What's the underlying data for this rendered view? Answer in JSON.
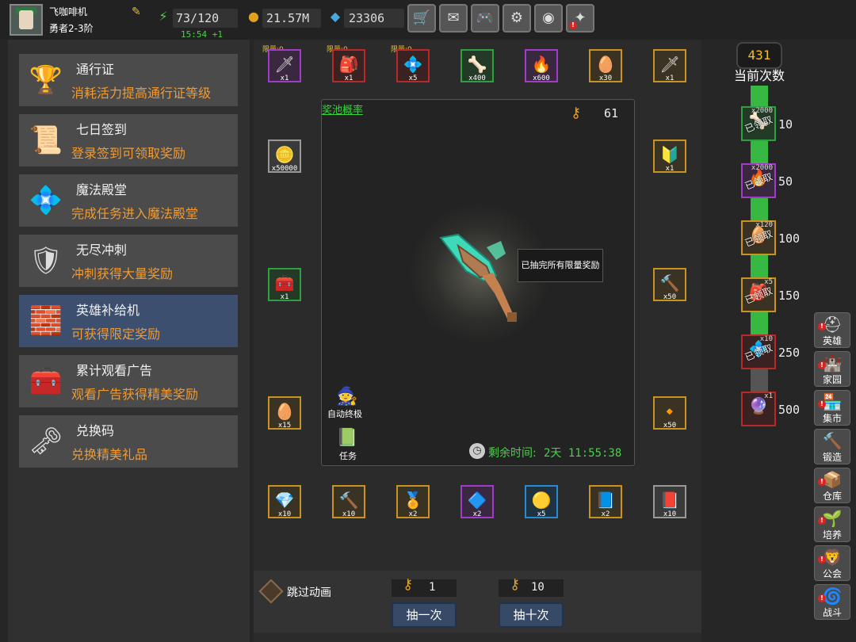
{
  "player": {
    "name": "飞咖啡机",
    "rank": "勇者2-3阶"
  },
  "resources": {
    "energy": "73/120",
    "energy_regen": "15:54 +1",
    "gold": "21.57M",
    "gems": "23306"
  },
  "top_buttons": [
    "shop-cart-icon",
    "mail-icon",
    "gamepad-icon",
    "settings-gear-icon",
    "colorwheel-icon",
    "sparkle-icon"
  ],
  "menu": [
    {
      "title": "通行证",
      "desc": "消耗活力提高通行证等级",
      "icon": "🏆"
    },
    {
      "title": "七日签到",
      "desc": "登录签到可领取奖励",
      "icon": "📜"
    },
    {
      "title": "魔法殿堂",
      "desc": "完成任务进入魔法殿堂",
      "icon": "💠"
    },
    {
      "title": "无尽冲刺",
      "desc": "冲刺获得大量奖励",
      "icon": "🛡"
    },
    {
      "title": "英雄补给机",
      "desc": "可获得限定奖励",
      "icon": "🧱",
      "active": true
    },
    {
      "title": "累计观看广告",
      "desc": "观看广告获得精美奖励",
      "icon": "🧰"
    },
    {
      "title": "兑换码",
      "desc": "兑换精美礼品",
      "icon": "🗝"
    }
  ],
  "pool": {
    "title": "奖池概率",
    "key_count": "61",
    "tooltip": "已抽完所有限量奖励",
    "auto_label": "自动终极",
    "task_label": "任务",
    "timer_label": "剩余时间:",
    "timer_value": "2天 11:55:38"
  },
  "limit_tag": "限量:0",
  "rewards_top": [
    {
      "count": "x1",
      "color": "purple",
      "icon": "🗡",
      "limited": true
    },
    {
      "count": "x1",
      "color": "red",
      "icon": "🎒",
      "limited": true
    },
    {
      "count": "x5",
      "color": "red",
      "icon": "💠",
      "limited": true
    },
    {
      "count": "x400",
      "color": "green",
      "icon": "🦴"
    },
    {
      "count": "x600",
      "color": "purple",
      "icon": "🔥"
    },
    {
      "count": "x30",
      "color": "gold",
      "icon": "🥚"
    },
    {
      "count": "x1",
      "color": "gold",
      "icon": "🗡"
    }
  ],
  "rewards_left": [
    {
      "count": "x50000",
      "color": "grey",
      "icon": "🪙"
    },
    {
      "count": "x1",
      "color": "green",
      "icon": "🧰"
    },
    {
      "count": "x15",
      "color": "gold",
      "icon": "🥚"
    }
  ],
  "rewards_right": [
    {
      "count": "x1",
      "color": "gold",
      "icon": "🔰"
    },
    {
      "count": "x50",
      "color": "gold",
      "icon": "🔨"
    },
    {
      "count": "x50",
      "color": "gold",
      "icon": "🔸"
    }
  ],
  "rewards_bottom": [
    {
      "count": "x10",
      "color": "gold",
      "icon": "💎"
    },
    {
      "count": "x10",
      "color": "gold",
      "icon": "🔨"
    },
    {
      "count": "x2",
      "color": "gold",
      "icon": "🏅"
    },
    {
      "count": "x2",
      "color": "purple",
      "icon": "🔷"
    },
    {
      "count": "x5",
      "color": "blue",
      "icon": "🟡"
    },
    {
      "count": "x2",
      "color": "gold",
      "icon": "📘"
    },
    {
      "count": "x10",
      "color": "grey",
      "icon": "📕"
    }
  ],
  "bottom": {
    "skip_label": "跳过动画",
    "single_cost": "1",
    "ten_cost": "10",
    "single_btn": "抽一次",
    "ten_btn": "抽十次"
  },
  "progress": {
    "draws": "431",
    "draws_label": "当前次数",
    "claimed_stamp": "已领取",
    "milestones": [
      {
        "value": "10",
        "count": "x2000",
        "color": "green",
        "icon": "🦴",
        "claimed": true
      },
      {
        "value": "50",
        "count": "x2000",
        "color": "purple",
        "icon": "🔥",
        "claimed": true
      },
      {
        "value": "100",
        "count": "x120",
        "color": "gold",
        "icon": "🥚",
        "claimed": true
      },
      {
        "value": "150",
        "count": "x5",
        "color": "gold",
        "icon": "🎒",
        "claimed": true
      },
      {
        "value": "250",
        "count": "x10",
        "color": "red",
        "icon": "💠",
        "claimed": true
      },
      {
        "value": "500",
        "count": "x1",
        "color": "red",
        "icon": "🔮",
        "claimed": false
      }
    ]
  },
  "nav": [
    {
      "label": "英雄",
      "icon": "⛑",
      "alert": true
    },
    {
      "label": "家园",
      "icon": "🏰",
      "alert": true
    },
    {
      "label": "集市",
      "icon": "🏪",
      "alert": true
    },
    {
      "label": "锻造",
      "icon": "🔨",
      "alert": false
    },
    {
      "label": "仓库",
      "icon": "📦",
      "alert": true
    },
    {
      "label": "培养",
      "icon": "🌱",
      "alert": true
    },
    {
      "label": "公会",
      "icon": "🦁",
      "alert": true
    },
    {
      "label": "战斗",
      "icon": "🌀",
      "alert": true
    }
  ]
}
